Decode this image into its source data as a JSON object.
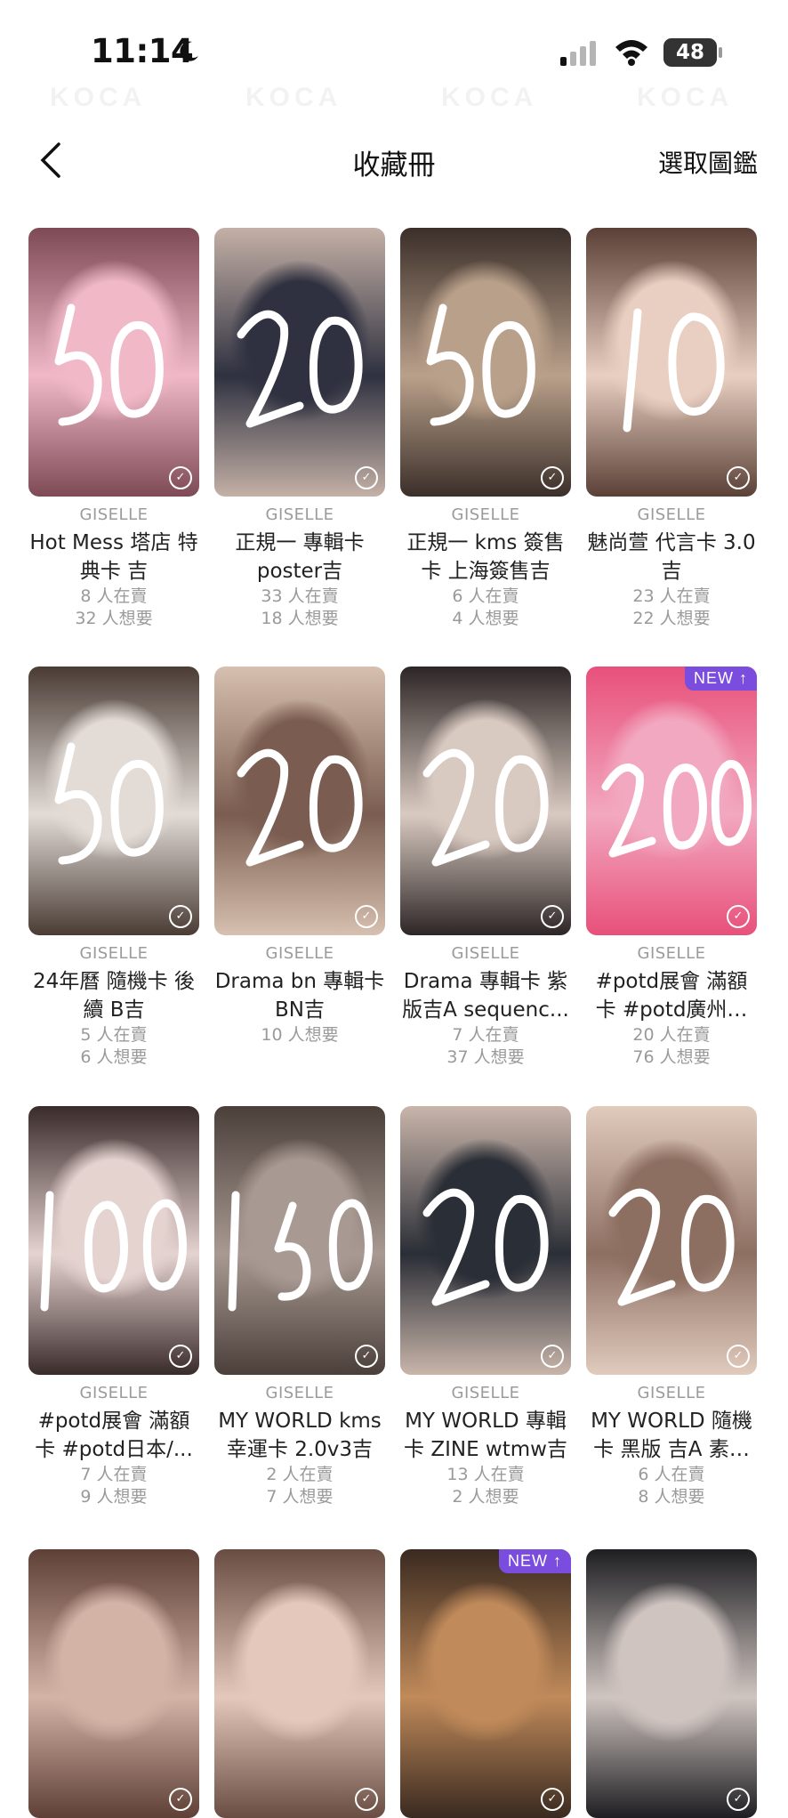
{
  "status": {
    "time": "11:14",
    "battery": "48"
  },
  "nav": {
    "title": "收藏冊",
    "action": "選取圖鑑"
  },
  "brand": {
    "watermark": "KOCA",
    "accent": "#7b4dde"
  },
  "cards": [
    {
      "artist": "GISELLE",
      "title": "Hot Mess 塔店 特典卡 吉",
      "selling": "8 人在賣",
      "wanting": "32 人想要",
      "scrawl": "50",
      "badge": ""
    },
    {
      "artist": "GISELLE",
      "title": "正規一 專輯卡 poster吉",
      "selling": "33 人在賣",
      "wanting": "18 人想要",
      "scrawl": "20",
      "badge": ""
    },
    {
      "artist": "GISELLE",
      "title": "正規一 kms 簽售卡 上海簽售吉",
      "selling": "6 人在賣",
      "wanting": "4 人想要",
      "scrawl": "50",
      "badge": ""
    },
    {
      "artist": "GISELLE",
      "title": "魅尚萱 代言卡 3.0吉",
      "selling": "23 人在賣",
      "wanting": "22 人想要",
      "scrawl": "10",
      "badge": ""
    },
    {
      "artist": "GISELLE",
      "title": "24年曆 隨機卡 後續 B吉",
      "selling": "5 人在賣",
      "wanting": "6 人想要",
      "scrawl": "50",
      "badge": ""
    },
    {
      "artist": "GISELLE",
      "title": "Drama bn 專輯卡 BN吉",
      "selling": "",
      "wanting": "10 人想要",
      "scrawl": "20",
      "badge": ""
    },
    {
      "artist": "GISELLE",
      "title": "Drama 專輯卡 紫版吉A sequenc...",
      "selling": "7 人在賣",
      "wanting": "37 人想要",
      "scrawl": "20",
      "badge": ""
    },
    {
      "artist": "GISELLE",
      "title": "#potd展會 滿額卡 #potd廣州…",
      "selling": "20 人在賣",
      "wanting": "76 人想要",
      "scrawl": "200",
      "badge": "NEW ↑"
    },
    {
      "artist": "GISELLE",
      "title": "#potd展會 滿額卡 #potd日本/...",
      "selling": "7 人在賣",
      "wanting": "9 人想要",
      "scrawl": "100",
      "badge": ""
    },
    {
      "artist": "GISELLE",
      "title": "MY WORLD kms 幸運卡 2.0v3吉",
      "selling": "2 人在賣",
      "wanting": "7 人想要",
      "scrawl": "150",
      "badge": ""
    },
    {
      "artist": "GISELLE",
      "title": "MY WORLD 專輯卡 ZINE wtmw吉",
      "selling": "13 人在賣",
      "wanting": "2 人想要",
      "scrawl": "20",
      "badge": ""
    },
    {
      "artist": "GISELLE",
      "title": "MY WORLD 隨機卡 黑版 吉A 素…",
      "selling": "6 人在賣",
      "wanting": "8 人想要",
      "scrawl": "20",
      "badge": ""
    },
    {
      "artist": "",
      "title": "",
      "selling": "",
      "wanting": "",
      "scrawl": "",
      "badge": ""
    },
    {
      "artist": "",
      "title": "",
      "selling": "",
      "wanting": "",
      "scrawl": "",
      "badge": ""
    },
    {
      "artist": "",
      "title": "",
      "selling": "",
      "wanting": "",
      "scrawl": "",
      "badge": "NEW ↑"
    },
    {
      "artist": "",
      "title": "",
      "selling": "",
      "wanting": "",
      "scrawl": "",
      "badge": ""
    }
  ]
}
